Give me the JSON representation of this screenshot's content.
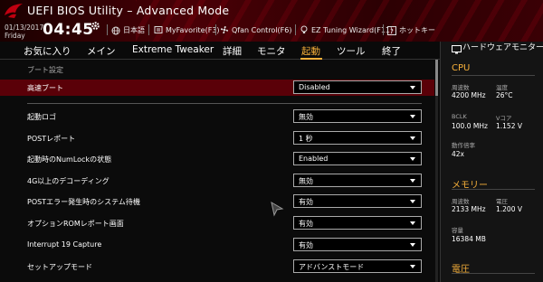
{
  "header": {
    "title": "UEFI BIOS Utility – Advanced Mode",
    "date": "01/13/2017",
    "day": "Friday",
    "time": "04:45",
    "buttons": {
      "language": "日本語",
      "myfavorite": "MyFavorite(F3)",
      "qfan": "Qfan Control(F6)",
      "ez_tuning": "EZ Tuning Wizard(F11)",
      "hotkey": "ホットキー"
    }
  },
  "menu": {
    "items": [
      "お気に入り",
      "メイン",
      "Extreme Tweaker",
      "詳細",
      "モニタ",
      "起動",
      "ツール",
      "終了"
    ],
    "active": "起動"
  },
  "main": {
    "breadcrumb": "ブート設定",
    "rows": [
      {
        "label": "高速ブート",
        "value": "Disabled"
      },
      {
        "label": "起動ロゴ",
        "value": "無効"
      },
      {
        "label": "POSTレポート",
        "value": "1 秒"
      },
      {
        "label": "起動時のNumLockの状態",
        "value": "Enabled"
      },
      {
        "label": "4G以上のデコーディング",
        "value": "無効"
      },
      {
        "label": "POSTエラー発生時のシステム待機",
        "value": "有効"
      },
      {
        "label": "オプションROMレポート画面",
        "value": "有効"
      },
      {
        "label": "Interrupt 19 Capture",
        "value": "有効"
      },
      {
        "label": "セットアップモード",
        "value": "アドバンストモード"
      }
    ]
  },
  "hardware": {
    "title": "ハードウェアモニター",
    "cpu": {
      "section": "CPU",
      "freq_label": "周波数",
      "freq": "4200 MHz",
      "temp_label": "温度",
      "temp": "26°C",
      "bclk_label": "BCLK",
      "bclk": "100.0 MHz",
      "vcore_label": "Vコア",
      "vcore": "1.152 V",
      "ratio_label": "動作倍率",
      "ratio": "42x"
    },
    "memory": {
      "section": "メモリー",
      "freq_label": "周波数",
      "freq": "2133 MHz",
      "volt_label": "電圧",
      "volt": "1.200 V",
      "cap_label": "容量",
      "cap": "16384 MB"
    },
    "voltage": {
      "section": "電圧"
    }
  },
  "colors": {
    "accent": "#f7b03a",
    "highlight_row": "#5a0008",
    "header_red": "#4a0006"
  }
}
